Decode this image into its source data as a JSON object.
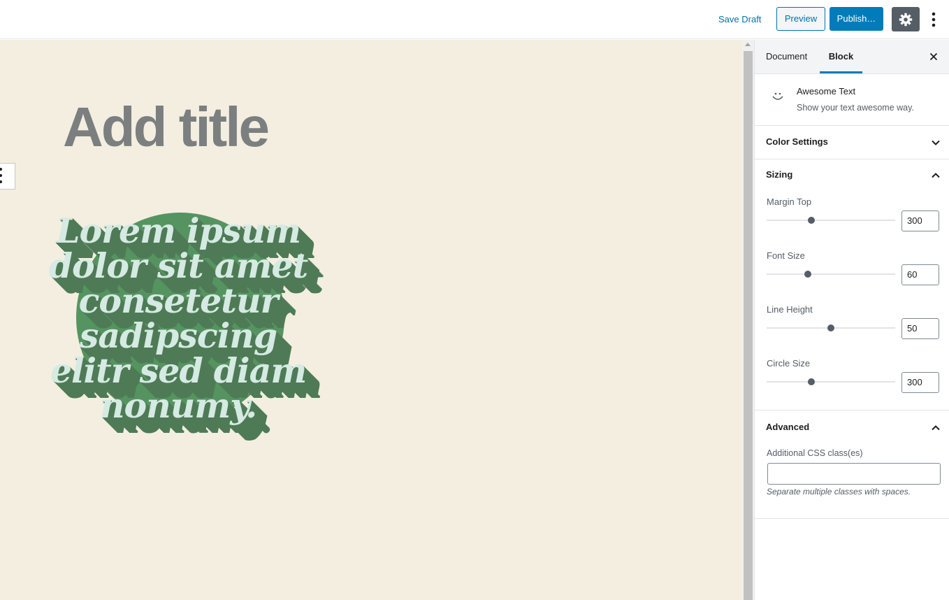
{
  "toolbar": {
    "save_draft": "Save Draft",
    "preview": "Preview",
    "publish": "Publish…",
    "settings_icon": "gear-icon",
    "more_icon": "vertical-ellipsis-icon"
  },
  "editor": {
    "title_placeholder": "Add title",
    "awesome_text_lines": [
      "Lorem ipsum",
      "dolor sit amet",
      "consetetur sadipscing",
      "elitr sed diam",
      "nonumy."
    ],
    "background_color": "#f4eee0",
    "circle_color": "#559460",
    "text_color": "#d5eae2",
    "shadow_color": "#4e7b56"
  },
  "sidebar": {
    "tabs": [
      {
        "label": "Document",
        "active": false
      },
      {
        "label": "Block",
        "active": true
      }
    ],
    "block": {
      "name": "Awesome Text",
      "description": "Show your text awesome way.",
      "icon": "smile-icon"
    },
    "panels": {
      "color_settings": {
        "label": "Color Settings",
        "open": false
      },
      "sizing": {
        "label": "Sizing",
        "open": true,
        "controls": [
          {
            "label": "Margin Top",
            "value": "300",
            "slider_fraction": 0.35
          },
          {
            "label": "Font Size",
            "value": "60",
            "slider_fraction": 0.32
          },
          {
            "label": "Line Height",
            "value": "50",
            "slider_fraction": 0.5
          },
          {
            "label": "Circle Size",
            "value": "300",
            "slider_fraction": 0.35
          }
        ]
      },
      "advanced": {
        "label": "Advanced",
        "open": true,
        "css_label": "Additional CSS class(es)",
        "css_value": "",
        "css_help": "Separate multiple classes with spaces."
      }
    }
  }
}
